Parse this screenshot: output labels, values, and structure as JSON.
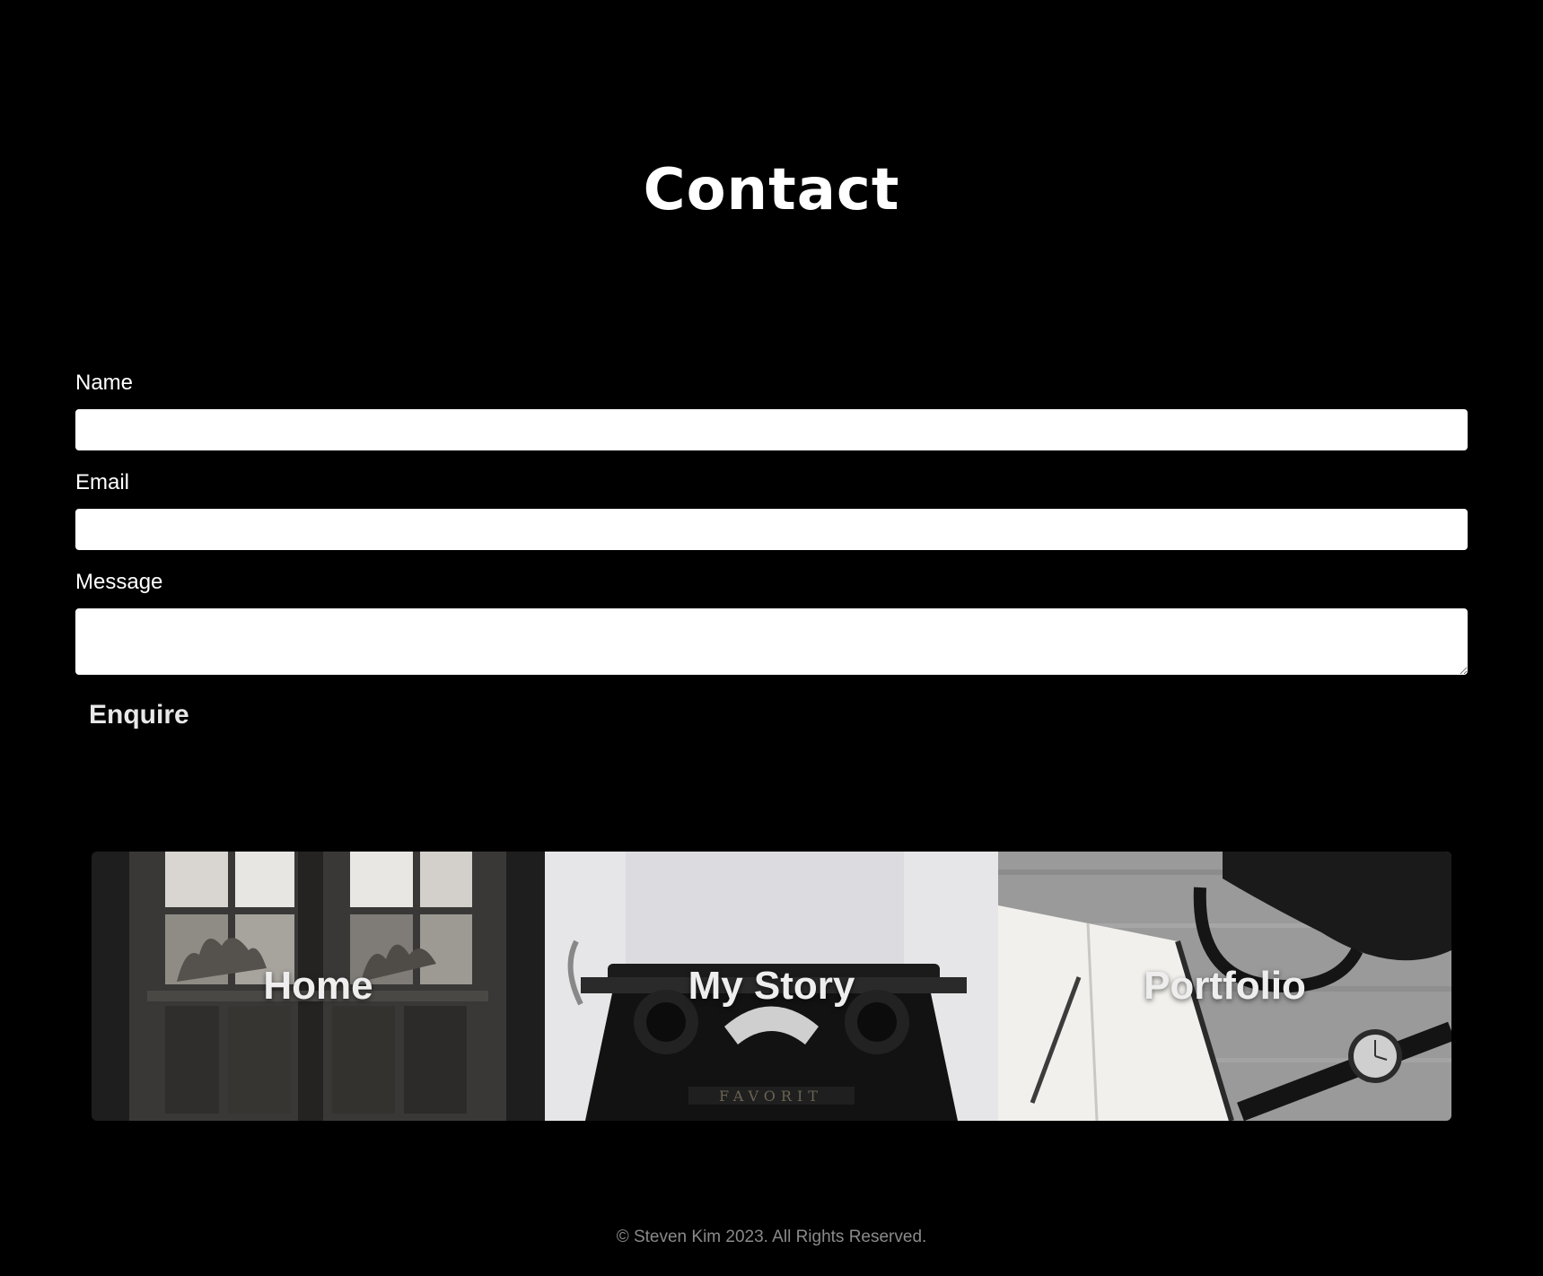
{
  "page": {
    "title": "Contact"
  },
  "form": {
    "name_label": "Name",
    "name_value": "",
    "email_label": "Email",
    "email_value": "",
    "message_label": "Message",
    "message_value": "",
    "submit_label": "Enquire"
  },
  "nav_cards": [
    {
      "label": "Home"
    },
    {
      "label": "My Story"
    },
    {
      "label": "Portfolio"
    }
  ],
  "footer": {
    "copyright": "© Steven Kim 2023. All Rights Reserved."
  },
  "colors": {
    "background": "#000000",
    "text": "#ffffff",
    "footer_text": "#8a8a8a",
    "input_background": "#ffffff"
  }
}
